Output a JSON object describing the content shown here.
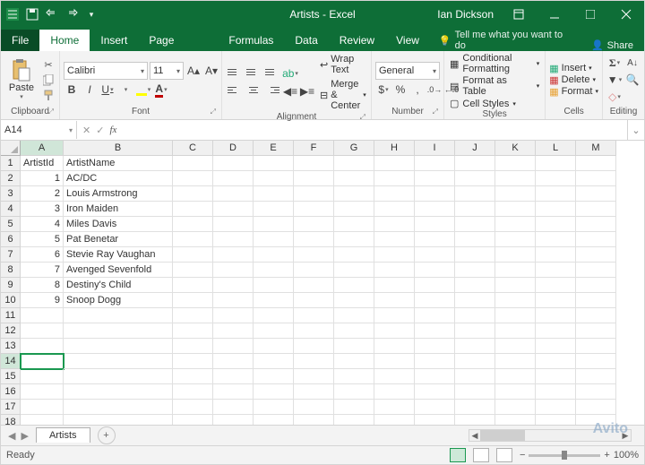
{
  "title": "Artists - Excel",
  "user": "Ian Dickson",
  "tabs": {
    "file": "File",
    "home": "Home",
    "insert": "Insert",
    "pagelayout": "Page Layout",
    "formulas": "Formulas",
    "data": "Data",
    "review": "Review",
    "view": "View"
  },
  "tellme": "Tell me what you want to do",
  "share": "Share",
  "ribbon": {
    "clipboard": {
      "paste": "Paste",
      "label": "Clipboard"
    },
    "font": {
      "name": "Calibri",
      "size": "11",
      "label": "Font"
    },
    "alignment": {
      "wrap": "Wrap Text",
      "merge": "Merge & Center",
      "label": "Alignment"
    },
    "number": {
      "format": "General",
      "label": "Number"
    },
    "styles": {
      "cond": "Conditional Formatting",
      "table": "Format as Table",
      "cell": "Cell Styles",
      "label": "Styles"
    },
    "cells": {
      "insert": "Insert",
      "delete": "Delete",
      "format": "Format",
      "label": "Cells"
    },
    "editing": {
      "label": "Editing"
    }
  },
  "namebox": "A14",
  "formula": "",
  "columns": [
    "A",
    "B",
    "C",
    "D",
    "E",
    "F",
    "G",
    "H",
    "I",
    "J",
    "K",
    "L",
    "M"
  ],
  "headers": {
    "a": "ArtistId",
    "b": "ArtistName"
  },
  "rows": [
    {
      "id": "1",
      "name": "AC/DC"
    },
    {
      "id": "2",
      "name": "Louis Armstrong"
    },
    {
      "id": "3",
      "name": "Iron Maiden"
    },
    {
      "id": "4",
      "name": "Miles Davis"
    },
    {
      "id": "5",
      "name": "Pat Benetar"
    },
    {
      "id": "6",
      "name": "Stevie Ray Vaughan"
    },
    {
      "id": "7",
      "name": "Avenged Sevenfold"
    },
    {
      "id": "8",
      "name": "Destiny's Child"
    },
    {
      "id": "9",
      "name": "Snoop Dogg"
    }
  ],
  "visibleRows": 20,
  "activeCell": {
    "row": 14,
    "col": 0
  },
  "sheet": {
    "name": "Artists"
  },
  "status": {
    "ready": "Ready",
    "zoom": "100%"
  },
  "watermark": "Avito"
}
